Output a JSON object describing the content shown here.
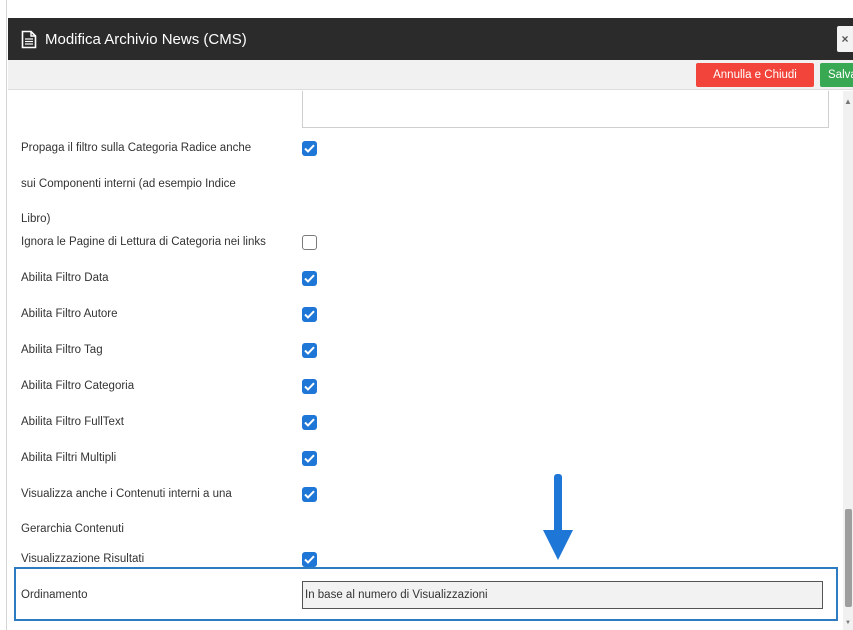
{
  "window": {
    "title": "Modifica Archivio News (CMS)",
    "close_label": "×"
  },
  "toolbar": {
    "cancel_label": "Annulla e Chiudi",
    "save_label": "Salva"
  },
  "form": {
    "fields": [
      {
        "label_lines": [
          "Propaga il filtro sulla Categoria Radice anche",
          "sui Componenti interni (ad esempio Indice",
          "Libro)"
        ],
        "checked": true
      },
      {
        "label": "Ignora le Pagine di Lettura di Categoria nei links",
        "checked": false
      },
      {
        "label": "Abilita Filtro Data",
        "checked": true
      },
      {
        "label": "Abilita Filtro Autore",
        "checked": true
      },
      {
        "label": "Abilita Filtro Tag",
        "checked": true
      },
      {
        "label": "Abilita Filtro Categoria",
        "checked": true
      },
      {
        "label": "Abilita Filtro FullText",
        "checked": true
      },
      {
        "label": "Abilita Filtri Multipli",
        "checked": true
      },
      {
        "label_lines": [
          "Visualizza anche i Contenuti interni a una",
          "Gerarchia Contenuti"
        ],
        "checked": true
      },
      {
        "label": "Visualizzazione Risultati",
        "checked": true
      }
    ],
    "ordering": {
      "label": "Ordinamento",
      "value": "In base al numero di Visualizzazioni"
    }
  },
  "colors": {
    "checkbox": "#1e76d6",
    "cancel": "#f2443a",
    "save": "#39a853",
    "highlight": "#2d7bc1",
    "arrow": "#1e76d6"
  },
  "icons": [
    "document-icon",
    "close-icon",
    "checkmark-icon",
    "arrow-down-icon"
  ]
}
